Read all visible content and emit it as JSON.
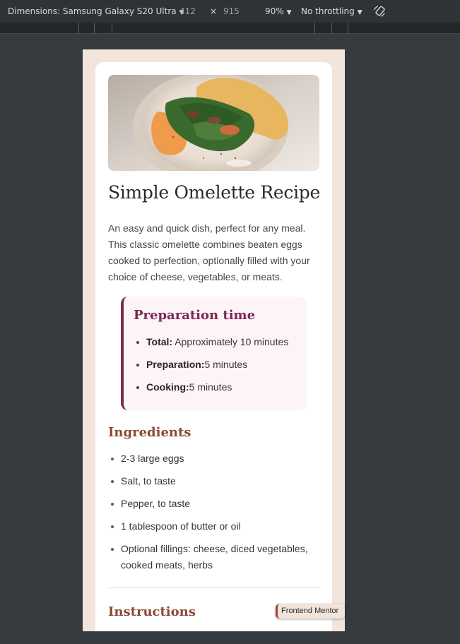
{
  "devtools": {
    "device_label": "Dimensions: Samsung Galaxy S20 Ultra",
    "width": "412",
    "times": "×",
    "height": "915",
    "zoom": "90%",
    "throttling": "No throttling"
  },
  "recipe": {
    "title": "Simple Omelette Recipe",
    "description": "An easy and quick dish, perfect for any meal. This classic omelette combines beaten eggs cooked to perfection, optionally filled with your choice of cheese, vegetables, or meats.",
    "preparation": {
      "heading": "Preparation time",
      "items": [
        {
          "label": "Total:",
          "value": " Approximately 10 minutes"
        },
        {
          "label": "Preparation:",
          "value": "5 minutes"
        },
        {
          "label": "Cooking:",
          "value": "5 minutes"
        }
      ]
    },
    "ingredients": {
      "heading": "Ingredients",
      "items": [
        "2-3 large eggs",
        "Salt, to taste",
        "Pepper, to taste",
        "1 tablespoon of butter or oil",
        "Optional fillings: cheese, diced vegetables, cooked meats, herbs"
      ]
    },
    "instructions": {
      "heading": "Instructions"
    }
  },
  "badge": {
    "label": "Frontend Mentor"
  },
  "colors": {
    "accent_plum": "#7a2950",
    "accent_brown": "#8a4a34",
    "page_bg": "#f3e5dc",
    "prep_bg": "#fdf4f8"
  }
}
